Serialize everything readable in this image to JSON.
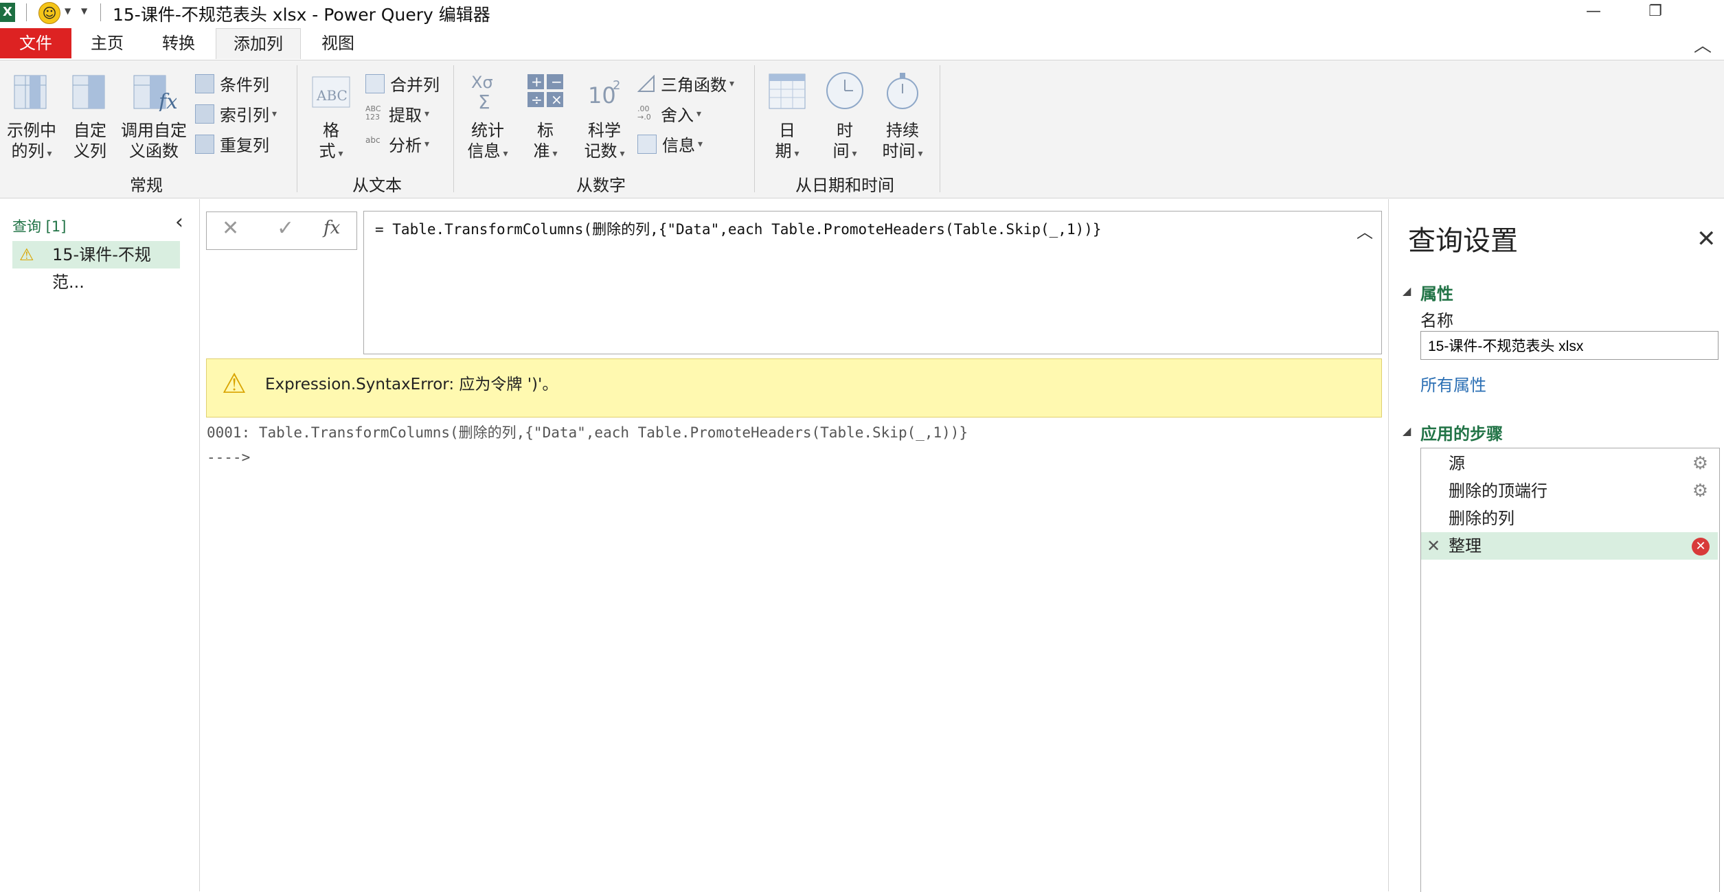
{
  "title_bar": {
    "title": "15-课件-不规范表头 xlsx - Power Query 编辑器",
    "excel_icon": "excel-icon",
    "smiley_icon": "smiley-icon"
  },
  "tabs": {
    "file": "文件",
    "home": "主页",
    "transform": "转换",
    "add_column": "添加列",
    "view": "视图"
  },
  "ribbon": {
    "general": {
      "label": "常规",
      "example_column": [
        "示例中",
        "的列"
      ],
      "custom_column": [
        "自定",
        "义列"
      ],
      "invoke_function": [
        "调用自定",
        "义函数"
      ],
      "conditional_column": "条件列",
      "index_column": "索引列",
      "duplicate_column": "重复列"
    },
    "from_text": {
      "label": "从文本",
      "format": [
        "格",
        "式"
      ],
      "merge_columns": "合并列",
      "extract": "提取",
      "parse": "分析"
    },
    "from_number": {
      "label": "从数字",
      "statistics": [
        "统计",
        "信息"
      ],
      "standard": [
        "标",
        "准"
      ],
      "scientific": [
        "科学",
        "记数"
      ],
      "trigonometry": "三角函数",
      "rounding": "舍入",
      "information": "信息"
    },
    "from_datetime": {
      "label": "从日期和时间",
      "date": [
        "日",
        "期"
      ],
      "time": [
        "时",
        "间"
      ],
      "duration": [
        "持续",
        "时间"
      ]
    }
  },
  "queries": {
    "header": "查询 [1]",
    "items": [
      "15-课件-不规范..."
    ]
  },
  "formula": {
    "fx": "fx",
    "text": "= Table.TransformColumns(删除的列,{\"Data\",each Table.PromoteHeaders(Table.Skip(_,1))}"
  },
  "error": {
    "message": "Expression.SyntaxError: 应为令牌 ')'。",
    "detail_line1": "0001: Table.TransformColumns(删除的列,{\"Data\",each Table.PromoteHeaders(Table.Skip(_,1))}",
    "detail_line2": "---->"
  },
  "settings": {
    "title": "查询设置",
    "properties_header": "属性",
    "name_label": "名称",
    "name_value": "15-课件-不规范表头 xlsx",
    "all_properties": "所有属性",
    "steps_header": "应用的步骤",
    "steps": [
      {
        "label": "源",
        "has_gear": true
      },
      {
        "label": "删除的顶端行",
        "has_gear": true
      },
      {
        "label": "删除的列",
        "has_gear": false
      },
      {
        "label": "整理",
        "has_gear": false,
        "error": true
      }
    ]
  },
  "colors": {
    "file_tab": "#dd2222",
    "accent_green": "#217346",
    "error_banner": "#fff9b0",
    "selection": "#d9eee0",
    "link_blue": "#2b6fb4"
  }
}
